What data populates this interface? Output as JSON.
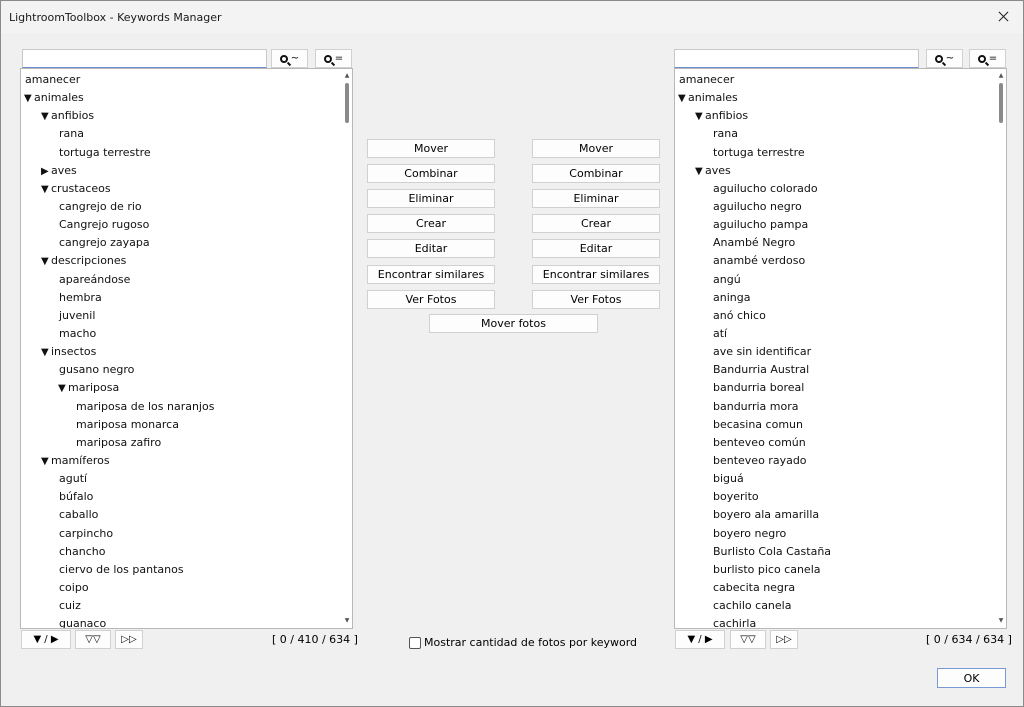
{
  "window": {
    "title": "LightroomToolbox - Keywords Manager"
  },
  "left_panel": {
    "search_value": "",
    "fuzzy_label": "~",
    "exact_label": "=",
    "items": [
      {
        "label": "amanecer",
        "level": 0,
        "toggle": ""
      },
      {
        "label": "animales",
        "level": 0,
        "toggle": "▼"
      },
      {
        "label": "anfibios",
        "level": 1,
        "toggle": "▼"
      },
      {
        "label": "rana",
        "level": 2,
        "toggle": ""
      },
      {
        "label": "tortuga terrestre",
        "level": 2,
        "toggle": ""
      },
      {
        "label": "aves",
        "level": 1,
        "toggle": "▶"
      },
      {
        "label": "crustaceos",
        "level": 1,
        "toggle": "▼"
      },
      {
        "label": "cangrejo de rio",
        "level": 2,
        "toggle": ""
      },
      {
        "label": "Cangrejo rugoso",
        "level": 2,
        "toggle": ""
      },
      {
        "label": "cangrejo zayapa",
        "level": 2,
        "toggle": ""
      },
      {
        "label": "descripciones",
        "level": 1,
        "toggle": "▼"
      },
      {
        "label": "apareándose",
        "level": 2,
        "toggle": ""
      },
      {
        "label": "hembra",
        "level": 2,
        "toggle": ""
      },
      {
        "label": "juvenil",
        "level": 2,
        "toggle": ""
      },
      {
        "label": "macho",
        "level": 2,
        "toggle": ""
      },
      {
        "label": "insectos",
        "level": 1,
        "toggle": "▼"
      },
      {
        "label": "gusano negro",
        "level": 2,
        "toggle": ""
      },
      {
        "label": "mariposa",
        "level": 2,
        "toggle": "▼"
      },
      {
        "label": "mariposa de los naranjos",
        "level": 3,
        "toggle": ""
      },
      {
        "label": "mariposa monarca",
        "level": 3,
        "toggle": ""
      },
      {
        "label": "mariposa zafiro",
        "level": 3,
        "toggle": ""
      },
      {
        "label": "mamíferos",
        "level": 1,
        "toggle": "▼"
      },
      {
        "label": "agutí",
        "level": 2,
        "toggle": ""
      },
      {
        "label": "búfalo",
        "level": 2,
        "toggle": ""
      },
      {
        "label": "caballo",
        "level": 2,
        "toggle": ""
      },
      {
        "label": "carpincho",
        "level": 2,
        "toggle": ""
      },
      {
        "label": "chancho",
        "level": 2,
        "toggle": ""
      },
      {
        "label": "ciervo de los pantanos",
        "level": 2,
        "toggle": ""
      },
      {
        "label": "coipo",
        "level": 2,
        "toggle": ""
      },
      {
        "label": "cuiz",
        "level": 2,
        "toggle": ""
      },
      {
        "label": "guanaco",
        "level": 2,
        "toggle": ""
      }
    ],
    "footer": {
      "toggle_label": "▼ / ▶",
      "collapse_label": "▽▽",
      "expand_label": "▷▷",
      "count": "[ 0 / 410 / 634 ]"
    }
  },
  "right_panel": {
    "search_value": "",
    "fuzzy_label": "~",
    "exact_label": "=",
    "items": [
      {
        "label": "amanecer",
        "level": 0,
        "toggle": ""
      },
      {
        "label": "animales",
        "level": 0,
        "toggle": "▼"
      },
      {
        "label": "anfibios",
        "level": 1,
        "toggle": "▼"
      },
      {
        "label": "rana",
        "level": 2,
        "toggle": ""
      },
      {
        "label": "tortuga terrestre",
        "level": 2,
        "toggle": ""
      },
      {
        "label": "aves",
        "level": 1,
        "toggle": "▼"
      },
      {
        "label": "aguilucho colorado",
        "level": 2,
        "toggle": ""
      },
      {
        "label": "aguilucho negro",
        "level": 2,
        "toggle": ""
      },
      {
        "label": "aguilucho pampa",
        "level": 2,
        "toggle": ""
      },
      {
        "label": "Anambé Negro",
        "level": 2,
        "toggle": ""
      },
      {
        "label": "anambé verdoso",
        "level": 2,
        "toggle": ""
      },
      {
        "label": "angú",
        "level": 2,
        "toggle": ""
      },
      {
        "label": "aninga",
        "level": 2,
        "toggle": ""
      },
      {
        "label": "anó chico",
        "level": 2,
        "toggle": ""
      },
      {
        "label": "atí",
        "level": 2,
        "toggle": ""
      },
      {
        "label": "ave sin identificar",
        "level": 2,
        "toggle": ""
      },
      {
        "label": "Bandurria Austral",
        "level": 2,
        "toggle": ""
      },
      {
        "label": "bandurria boreal",
        "level": 2,
        "toggle": ""
      },
      {
        "label": "bandurria mora",
        "level": 2,
        "toggle": ""
      },
      {
        "label": "becasina comun",
        "level": 2,
        "toggle": ""
      },
      {
        "label": "benteveo común",
        "level": 2,
        "toggle": ""
      },
      {
        "label": "benteveo rayado",
        "level": 2,
        "toggle": ""
      },
      {
        "label": "biguá",
        "level": 2,
        "toggle": ""
      },
      {
        "label": "boyerito",
        "level": 2,
        "toggle": ""
      },
      {
        "label": "boyero ala amarilla",
        "level": 2,
        "toggle": ""
      },
      {
        "label": "boyero negro",
        "level": 2,
        "toggle": ""
      },
      {
        "label": "Burlisto Cola Castaña",
        "level": 2,
        "toggle": ""
      },
      {
        "label": "burlisto pico canela",
        "level": 2,
        "toggle": ""
      },
      {
        "label": "cabecita negra",
        "level": 2,
        "toggle": ""
      },
      {
        "label": "cachilo canela",
        "level": 2,
        "toggle": ""
      },
      {
        "label": "cachirla",
        "level": 2,
        "toggle": ""
      }
    ],
    "footer": {
      "toggle_label": "▼ / ▶",
      "collapse_label": "▽▽",
      "expand_label": "▷▷",
      "count": "[ 0 / 634 / 634 ]"
    }
  },
  "actions": {
    "left": [
      "Mover",
      "Combinar",
      "Eliminar",
      "Crear",
      "Editar",
      "Encontrar similares",
      "Ver Fotos"
    ],
    "right": [
      "Mover",
      "Combinar",
      "Eliminar",
      "Crear",
      "Editar",
      "Encontrar similares",
      "Ver Fotos"
    ],
    "move_photos": "Mover fotos"
  },
  "show_count_checkbox": {
    "label": "Mostrar cantidad de fotos por keyword",
    "checked": false
  },
  "ok_label": "OK"
}
